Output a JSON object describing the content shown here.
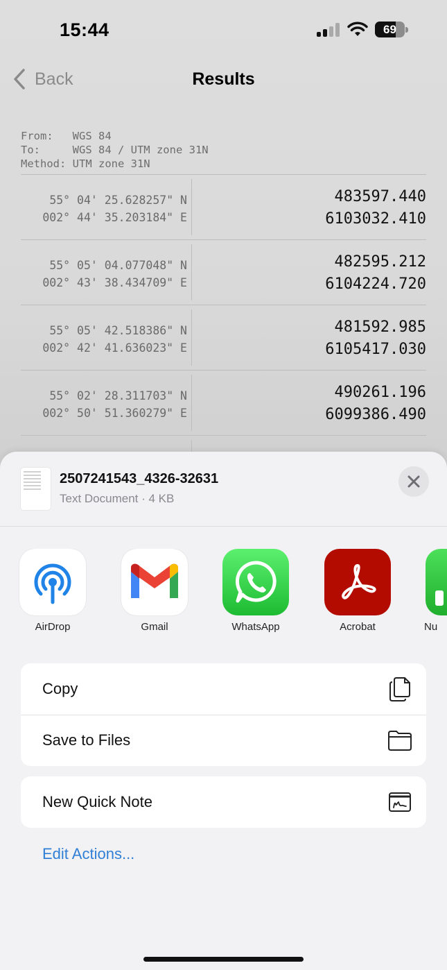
{
  "status_bar": {
    "time": "15:44",
    "battery_level": "69"
  },
  "nav": {
    "back_label": "Back",
    "title": "Results"
  },
  "meta": {
    "from": "From:   WGS 84",
    "to": "To:     WGS 84 / UTM zone 31N",
    "method": "Method: UTM zone 31N"
  },
  "results": [
    {
      "lat": "55° 04' 25.628257\" N",
      "lon": "002° 44' 35.203184\" E",
      "easting": "483597.440",
      "northing": "6103032.410"
    },
    {
      "lat": "55° 05' 04.077048\" N",
      "lon": "002° 43' 38.434709\" E",
      "easting": "482595.212",
      "northing": "6104224.720"
    },
    {
      "lat": "55° 05' 42.518386\" N",
      "lon": "002° 42' 41.636023\" E",
      "easting": "481592.985",
      "northing": "6105417.030"
    },
    {
      "lat": "55° 02' 28.311703\" N",
      "lon": "002° 50' 51.360279\" E",
      "easting": "490261.196",
      "northing": "6099386.490"
    }
  ],
  "share_sheet": {
    "file_name": "2507241543_4326-32631",
    "file_info": "Text Document · 4 KB",
    "apps": [
      {
        "label": "AirDrop",
        "icon": "airdrop-icon"
      },
      {
        "label": "Gmail",
        "icon": "gmail-icon"
      },
      {
        "label": "WhatsApp",
        "icon": "whatsapp-icon"
      },
      {
        "label": "Acrobat",
        "icon": "acrobat-icon"
      },
      {
        "label": "Nu",
        "icon": "numbers-icon"
      }
    ],
    "actions": [
      {
        "label": "Copy",
        "icon": "copy-icon"
      },
      {
        "label": "Save to Files",
        "icon": "folder-icon"
      }
    ],
    "actions2": [
      {
        "label": "New Quick Note",
        "icon": "quick-note-icon"
      }
    ],
    "edit_actions": "Edit Actions..."
  },
  "colors": {
    "link_blue": "#2f7fd6",
    "acrobat_red": "#b30b00",
    "whatsapp_green": "#25d366"
  }
}
